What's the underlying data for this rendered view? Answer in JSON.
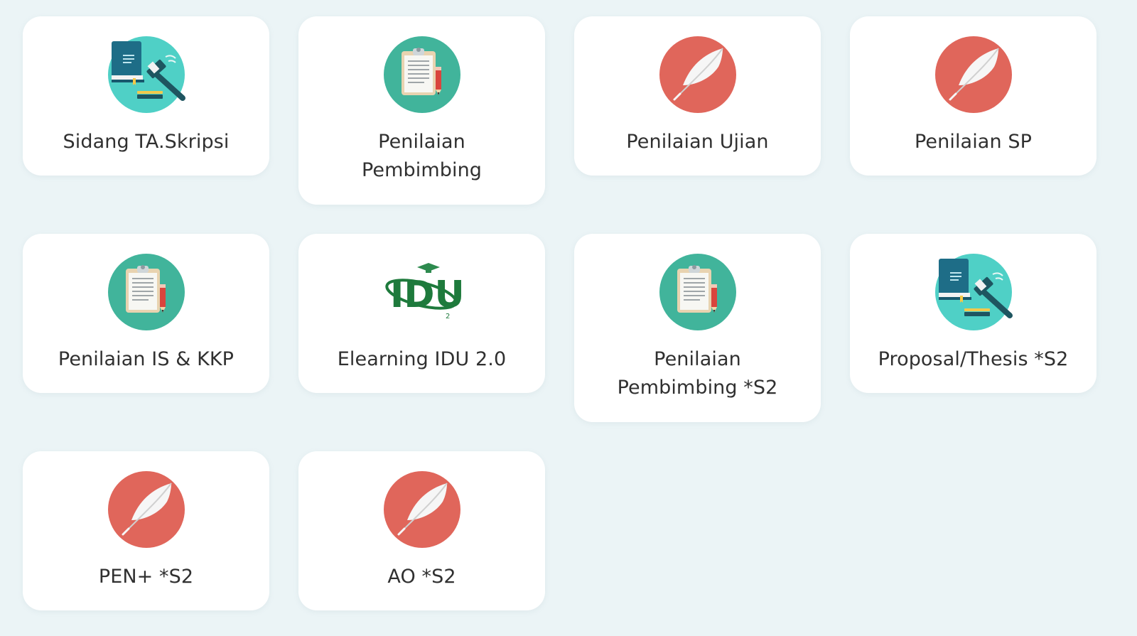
{
  "colors": {
    "background": "#ebf4f6",
    "card": "#ffffff",
    "teal_icon": "#4cc9c0",
    "green_icon": "#40b39a",
    "red_icon": "#e0655a",
    "idu_green": "#1e7a3c"
  },
  "menu": {
    "items": [
      {
        "label": "Sidang TA.Skripsi",
        "icon": "book-gavel-icon"
      },
      {
        "label": "Penilaian Pembimbing",
        "icon": "clipboard-icon"
      },
      {
        "label": "Penilaian Ujian",
        "icon": "feather-icon"
      },
      {
        "label": "Penilaian SP",
        "icon": "feather-icon"
      },
      {
        "label": "Penilaian IS & KKP",
        "icon": "clipboard-icon"
      },
      {
        "label": "Elearning IDU 2.0",
        "icon": "idu-logo-icon",
        "logo_text": "IDU",
        "logo_sub": "2"
      },
      {
        "label": "Penilaian Pembimbing *S2",
        "icon": "clipboard-icon"
      },
      {
        "label": "Proposal/Thesis *S2",
        "icon": "book-gavel-icon"
      },
      {
        "label": "PEN+ *S2",
        "icon": "feather-icon"
      },
      {
        "label": "AO *S2",
        "icon": "feather-icon"
      }
    ]
  }
}
